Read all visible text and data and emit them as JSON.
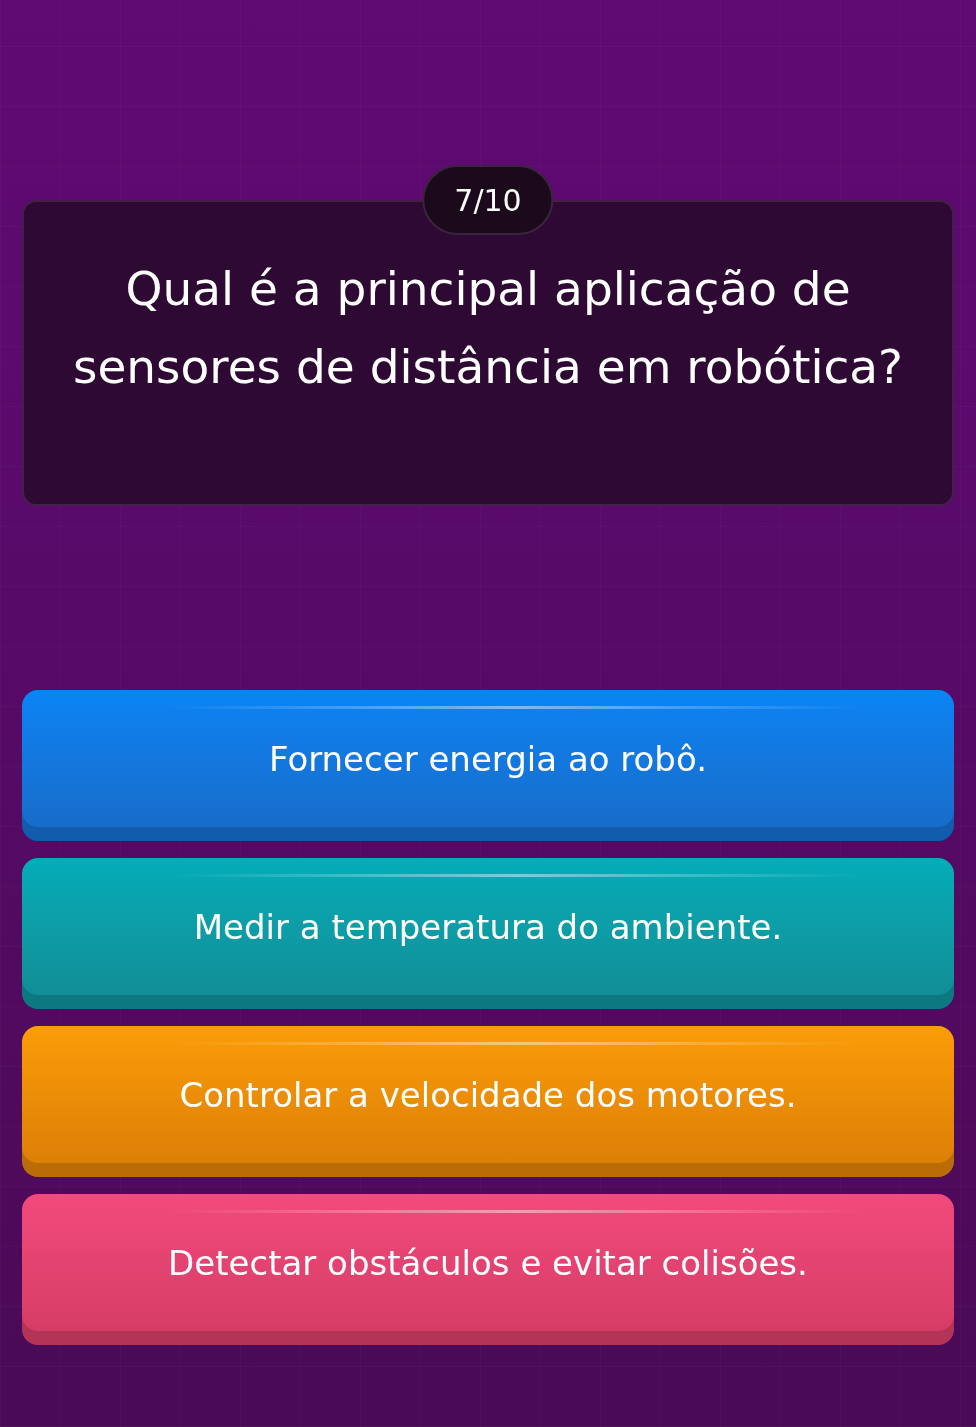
{
  "progress": "7/10",
  "question": "Qual é a principal aplicação de sensores de distância em robótica?",
  "answers": [
    {
      "label": "Fornecer energia ao robô.",
      "color": "#0a84f5"
    },
    {
      "label": "Medir a temperatura do ambiente.",
      "color": "#03adb8"
    },
    {
      "label": "Controlar a velocidade dos motores.",
      "color": "#fb9c08"
    },
    {
      "label": "Detectar obstáculos e evitar colisões.",
      "color": "#f24a7c"
    }
  ]
}
